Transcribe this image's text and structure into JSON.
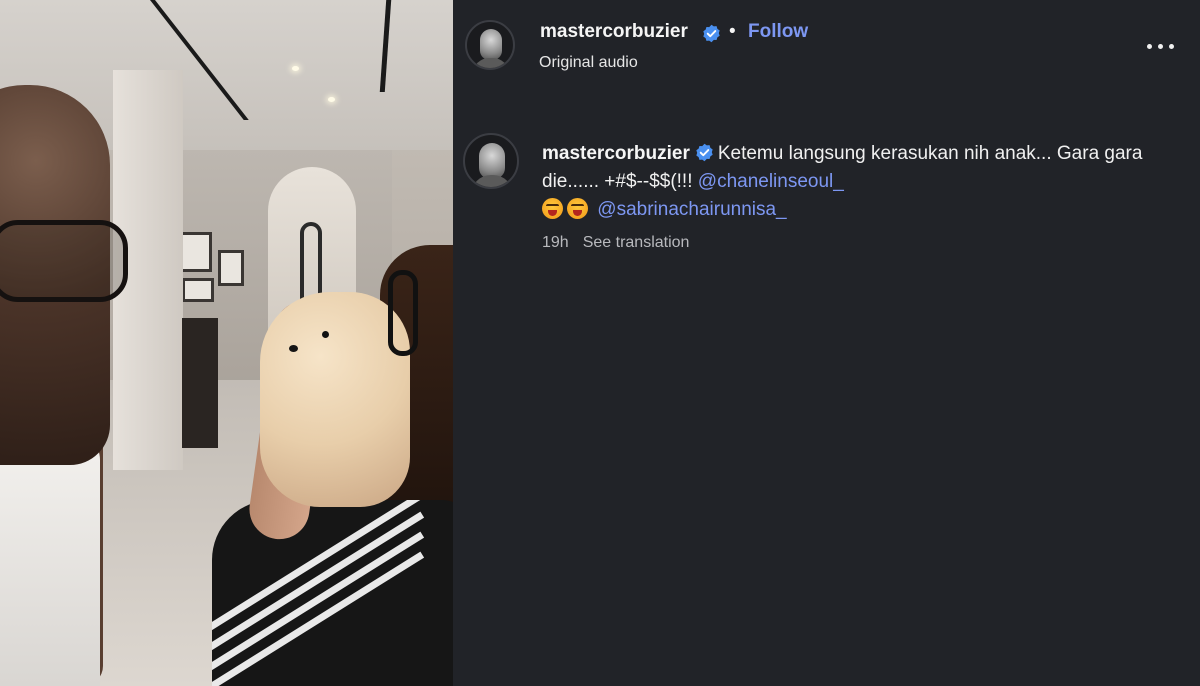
{
  "post": {
    "username": "mastercorbuzier",
    "separator": "•",
    "follow_label": "Follow",
    "audio_label": "Original audio",
    "more_icon": "more-options-icon"
  },
  "caption": {
    "username": "mastercorbuzier",
    "text": "Ketemu langsung kerasukan nih anak... Gara gara die...... +#$--$$(!!! ",
    "mention1": "@chanelinseoul_",
    "mention2": "@sabrinachairunnisa_",
    "emoji_name": "face-with-open-mouth-vomiting-emoji",
    "timestamp": "19h",
    "see_translation": "See translation"
  },
  "colors": {
    "panel_bg": "#212328",
    "link_blue": "#7d97f2",
    "verified_blue": "#4a90f0"
  }
}
